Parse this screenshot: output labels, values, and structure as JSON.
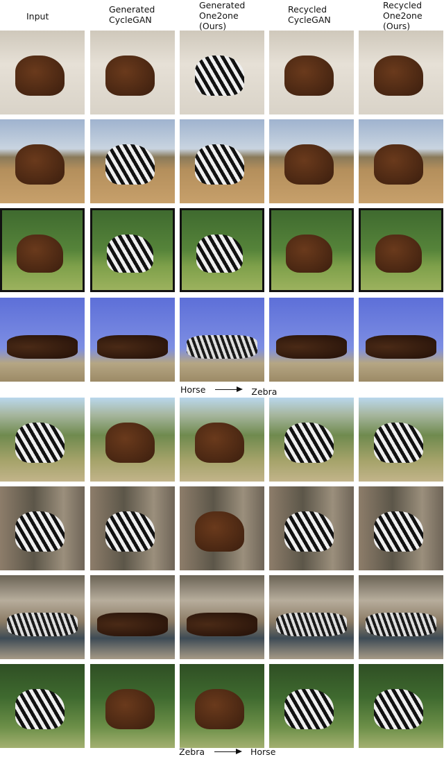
{
  "figure": {
    "columns": [
      {
        "id": "input",
        "label": "Input"
      },
      {
        "id": "gen_cyclegan",
        "label": "Generated\nCycleGAN"
      },
      {
        "id": "gen_one2one",
        "label": "Generated\nOne2one\n(Ours)"
      },
      {
        "id": "rec_cyclegan",
        "label": "Recycled\nCycleGAN"
      },
      {
        "id": "rec_one2one",
        "label": "Recycled\nOne2one\n(Ours)"
      }
    ],
    "sections": [
      {
        "caption_from": "Horse",
        "caption_to": "Zebra",
        "rows": [
          {
            "scene": "stable",
            "subjects": [
              "horse",
              "horse",
              "zebra",
              "horse",
              "horse"
            ]
          },
          {
            "scene": "field",
            "subjects": [
              "horse",
              "zebra",
              "zebra",
              "horse",
              "horse"
            ]
          },
          {
            "scene": "bush",
            "subjects": [
              "horse",
              "zebra",
              "zebra",
              "horse",
              "horse"
            ]
          },
          {
            "scene": "sky",
            "subjects": [
              "herd",
              "herd",
              "herdz",
              "herd",
              "herd"
            ]
          }
        ]
      },
      {
        "caption_from": "Zebra",
        "caption_to": "Horse",
        "rows": [
          {
            "scene": "grass",
            "subjects": [
              "zebra",
              "horse",
              "horse",
              "zebra",
              "zebra"
            ]
          },
          {
            "scene": "rock",
            "subjects": [
              "zebra",
              "zebra",
              "horse",
              "zebra",
              "zebra"
            ]
          },
          {
            "scene": "water",
            "subjects": [
              "herdz",
              "herd",
              "herd",
              "herdz",
              "herdz"
            ]
          },
          {
            "scene": "green",
            "subjects": [
              "zebra",
              "horse",
              "horse",
              "zebra",
              "zebra"
            ]
          }
        ]
      }
    ]
  }
}
